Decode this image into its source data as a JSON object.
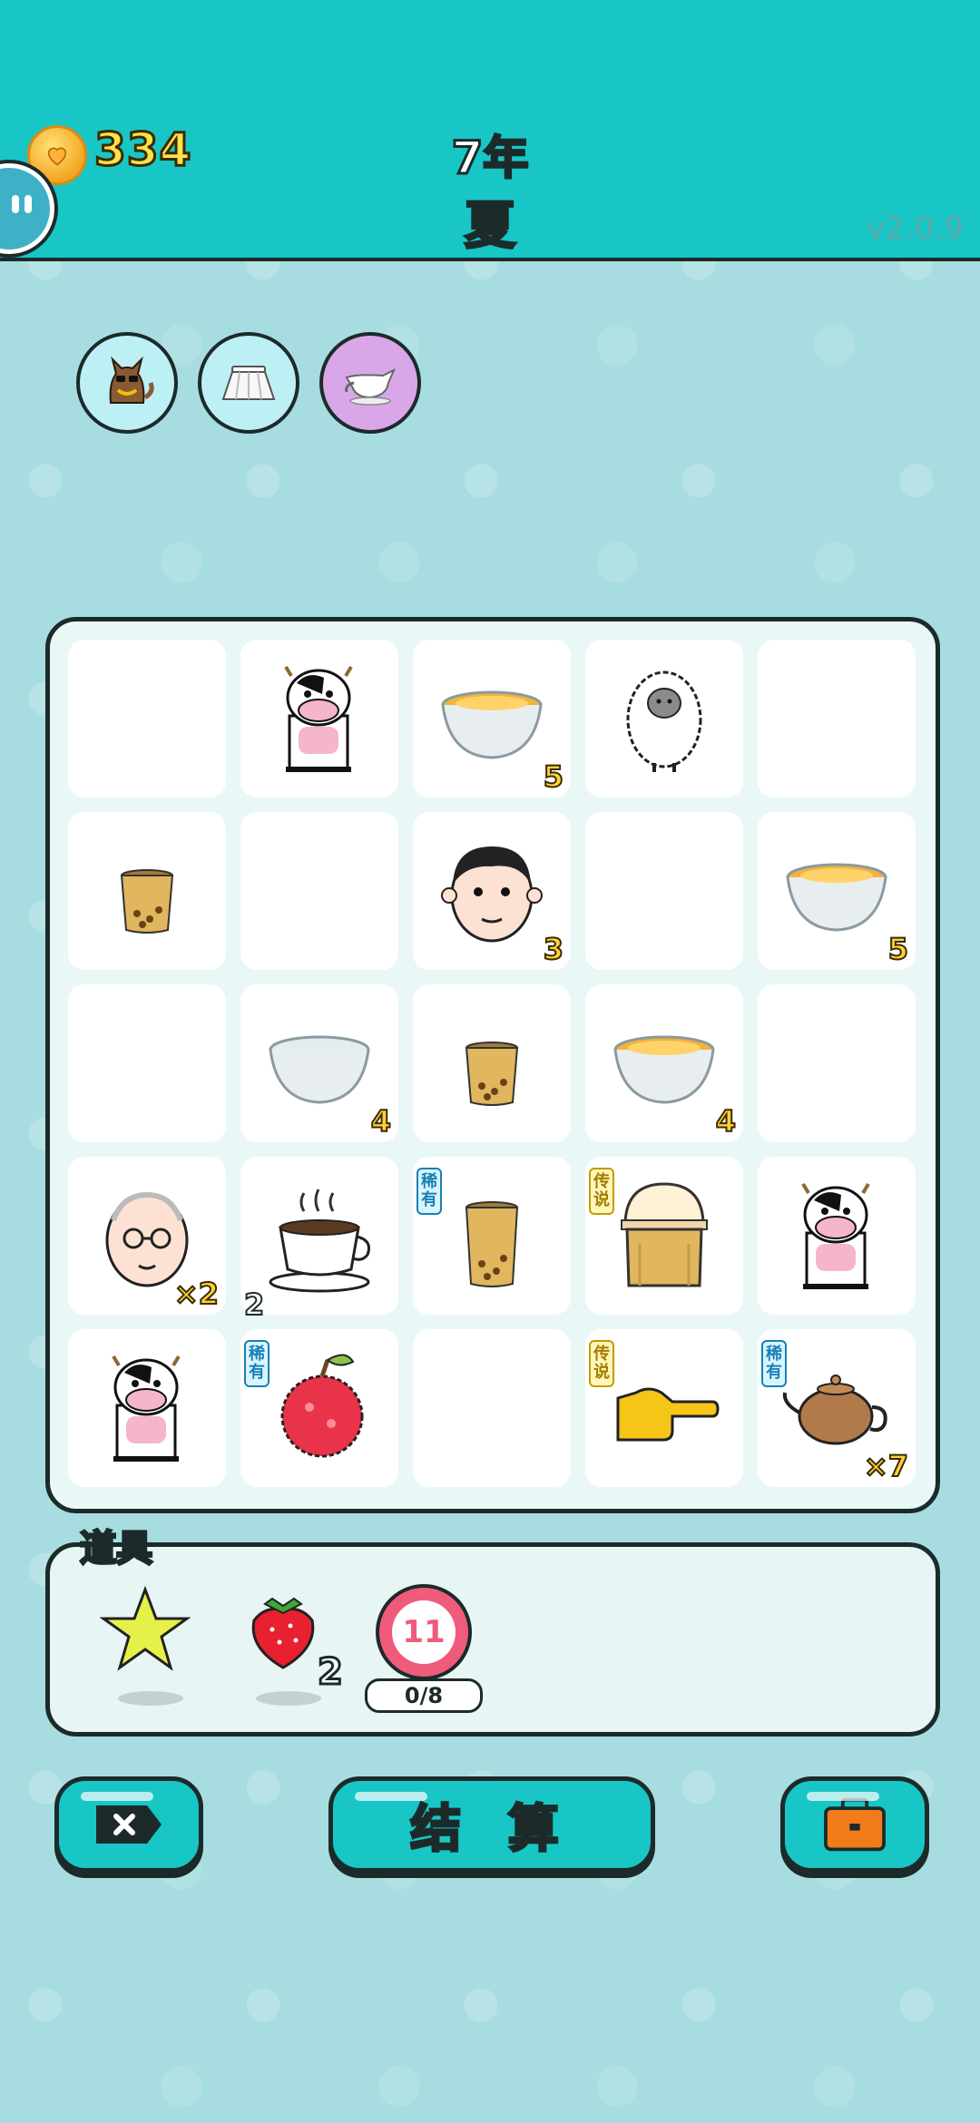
{
  "header": {
    "coins": "334",
    "year": "7年",
    "season": "夏",
    "version": "v2.0.9"
  },
  "buffs": [
    {
      "icon": "cat-with-sunglasses-icon"
    },
    {
      "icon": "white-skirt-icon"
    },
    {
      "icon": "milk-jug-icon"
    }
  ],
  "board": {
    "rows": [
      [
        {
          "icon": "empty"
        },
        {
          "icon": "cow-icon"
        },
        {
          "icon": "bowl-soup-icon",
          "count": "5"
        },
        {
          "icon": "sheep-icon"
        },
        {
          "icon": "empty"
        }
      ],
      [
        {
          "icon": "milk-tea-cup-icon"
        },
        {
          "icon": "empty"
        },
        {
          "icon": "man-face-icon",
          "count": "3"
        },
        {
          "icon": "empty"
        },
        {
          "icon": "bowl-soup-icon",
          "count": "5"
        }
      ],
      [
        {
          "icon": "empty"
        },
        {
          "icon": "empty-bowl-icon",
          "count": "4"
        },
        {
          "icon": "milk-tea-cup-icon"
        },
        {
          "icon": "bowl-soup-icon",
          "count": "4"
        },
        {
          "icon": "empty"
        }
      ],
      [
        {
          "icon": "grandpa-face-icon",
          "count": "×2"
        },
        {
          "icon": "coffee-cup-icon",
          "count_left": "2"
        },
        {
          "icon": "tall-milk-tea-icon",
          "tag": "稀有"
        },
        {
          "icon": "bubble-tea-dome-icon",
          "tag": "传说"
        },
        {
          "icon": "cow-icon"
        }
      ],
      [
        {
          "icon": "cow-icon"
        },
        {
          "icon": "lychee-icon",
          "tag": "稀有"
        },
        {
          "icon": "empty"
        },
        {
          "icon": "pointing-hand-icon",
          "tag": "传说"
        },
        {
          "icon": "teapot-icon",
          "tag": "稀有",
          "count": "×7"
        }
      ]
    ]
  },
  "items": {
    "title": "道具",
    "list": [
      {
        "icon": "star-icon"
      },
      {
        "icon": "strawberry-icon",
        "count": "2"
      },
      {
        "icon": "target-icon",
        "value": "11",
        "progress": "0/8"
      }
    ]
  },
  "buttons": {
    "left_icon": "close-tag-icon",
    "settle_label": "结 算",
    "right_icon": "briefcase-icon"
  },
  "colors": {
    "header_bg": "#18c6c6",
    "page_bg": "#a7dde0",
    "accent_yellow": "#ffd23a",
    "button_bg": "#18c6c6"
  }
}
